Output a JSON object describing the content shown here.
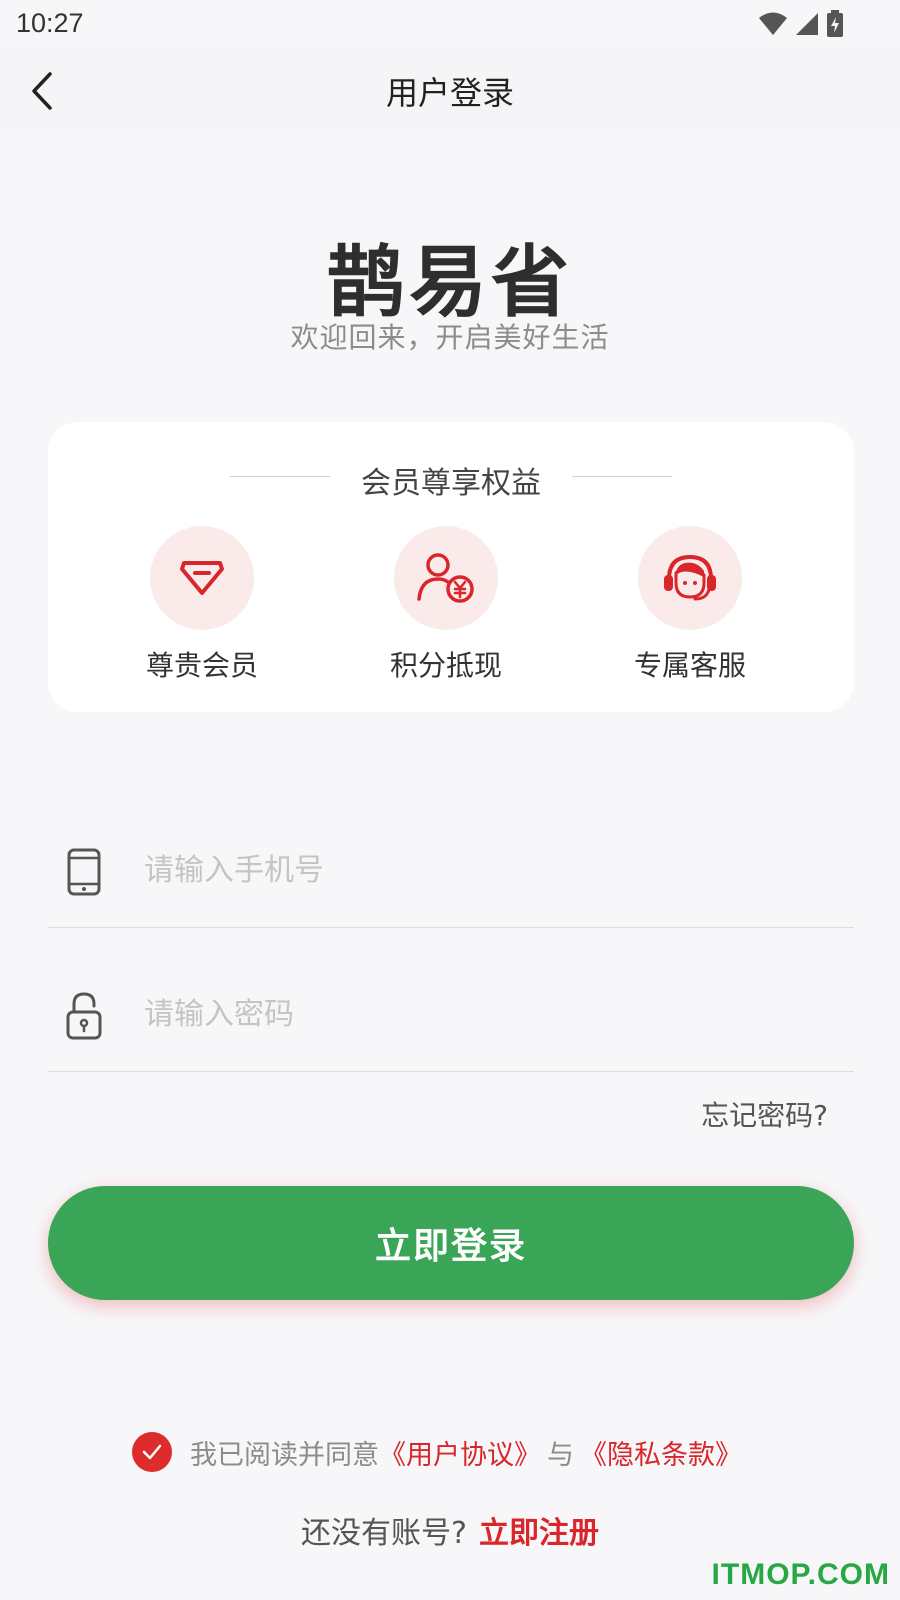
{
  "status_bar": {
    "time": "10:27",
    "icons": [
      "wifi-icon",
      "signal-icon",
      "battery-charging-icon"
    ]
  },
  "nav": {
    "title": "用户登录",
    "back_icon": "chevron-left-icon"
  },
  "brand": {
    "name": "鹊易省",
    "slogan": "欢迎回来，开启美好生活"
  },
  "benefits": {
    "title": "会员尊享权益",
    "items": [
      {
        "label": "尊贵会员",
        "icon": "diamond-icon"
      },
      {
        "label": "积分抵现",
        "icon": "user-yuan-icon"
      },
      {
        "label": "专属客服",
        "icon": "customer-service-icon"
      }
    ]
  },
  "form": {
    "phone": {
      "placeholder": "请输入手机号",
      "value": "",
      "icon": "phone-icon"
    },
    "password": {
      "placeholder": "请输入密码",
      "value": "",
      "icon": "lock-icon"
    },
    "forgot_label": "忘记密码?",
    "login_label": "立即登录"
  },
  "agreement": {
    "checked": true,
    "prefix": "我已阅读并同意",
    "user_agreement": "《用户协议》",
    "joiner": "与",
    "privacy_policy": "《隐私条款》"
  },
  "register": {
    "prompt": "还没有账号?",
    "link_label": "立即注册"
  },
  "watermark": "ITMOP.COM",
  "colors": {
    "accent_red": "#d9262b",
    "button_green": "#3aa556",
    "icon_bg": "#fbeaea"
  }
}
